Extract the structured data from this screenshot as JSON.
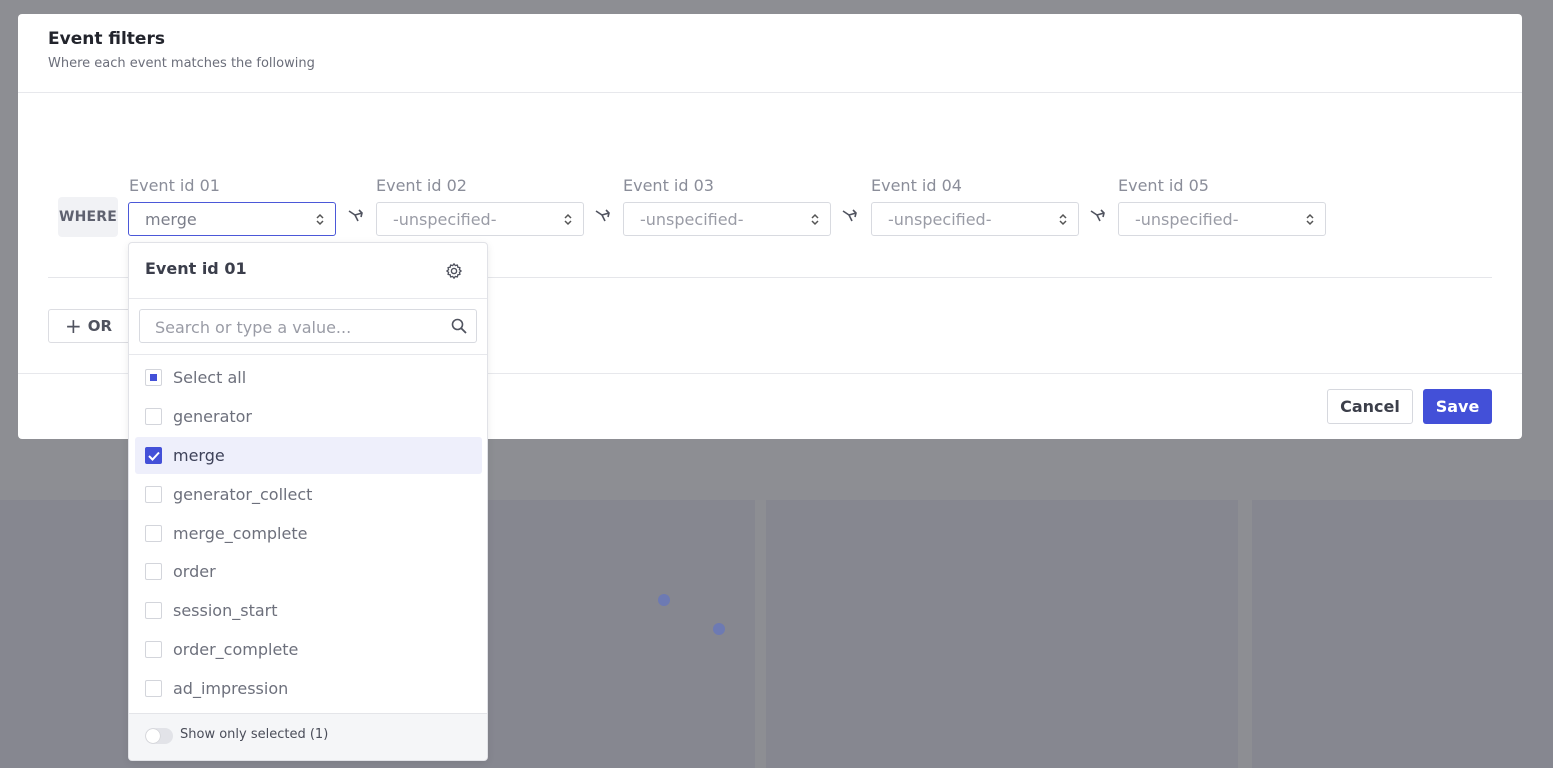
{
  "modal": {
    "title": "Event filters",
    "subtitle": "Where each event matches the following",
    "where_label": "WHERE",
    "fields": [
      {
        "label": "Event id 01",
        "value": "merge"
      },
      {
        "label": "Event id 02",
        "value": "-unspecified-"
      },
      {
        "label": "Event id 03",
        "value": "-unspecified-"
      },
      {
        "label": "Event id 04",
        "value": "-unspecified-"
      },
      {
        "label": "Event id 05",
        "value": "-unspecified-"
      }
    ],
    "or_label": "OR",
    "cancel_label": "Cancel",
    "save_label": "Save"
  },
  "dropdown": {
    "title": "Event id 01",
    "search_placeholder": "Search or type a value...",
    "select_all_label": "Select all",
    "options": [
      {
        "label": "generator",
        "checked": false
      },
      {
        "label": "merge",
        "checked": true
      },
      {
        "label": "generator_collect",
        "checked": false
      },
      {
        "label": "merge_complete",
        "checked": false
      },
      {
        "label": "order",
        "checked": false
      },
      {
        "label": "session_start",
        "checked": false
      },
      {
        "label": "order_complete",
        "checked": false
      },
      {
        "label": "ad_impression",
        "checked": false
      }
    ],
    "show_only_selected_label": "Show only selected (1)",
    "show_only_selected_on": false
  },
  "icons": {
    "select": "updown-chevron-icon",
    "connector": "split-arrow-icon",
    "settings": "gear-icon",
    "search": "search-icon",
    "check": "checkmark-icon"
  },
  "colors": {
    "accent": "#4350d8",
    "overlay": "#8d8e93",
    "selected_row": "#eeeffb"
  }
}
